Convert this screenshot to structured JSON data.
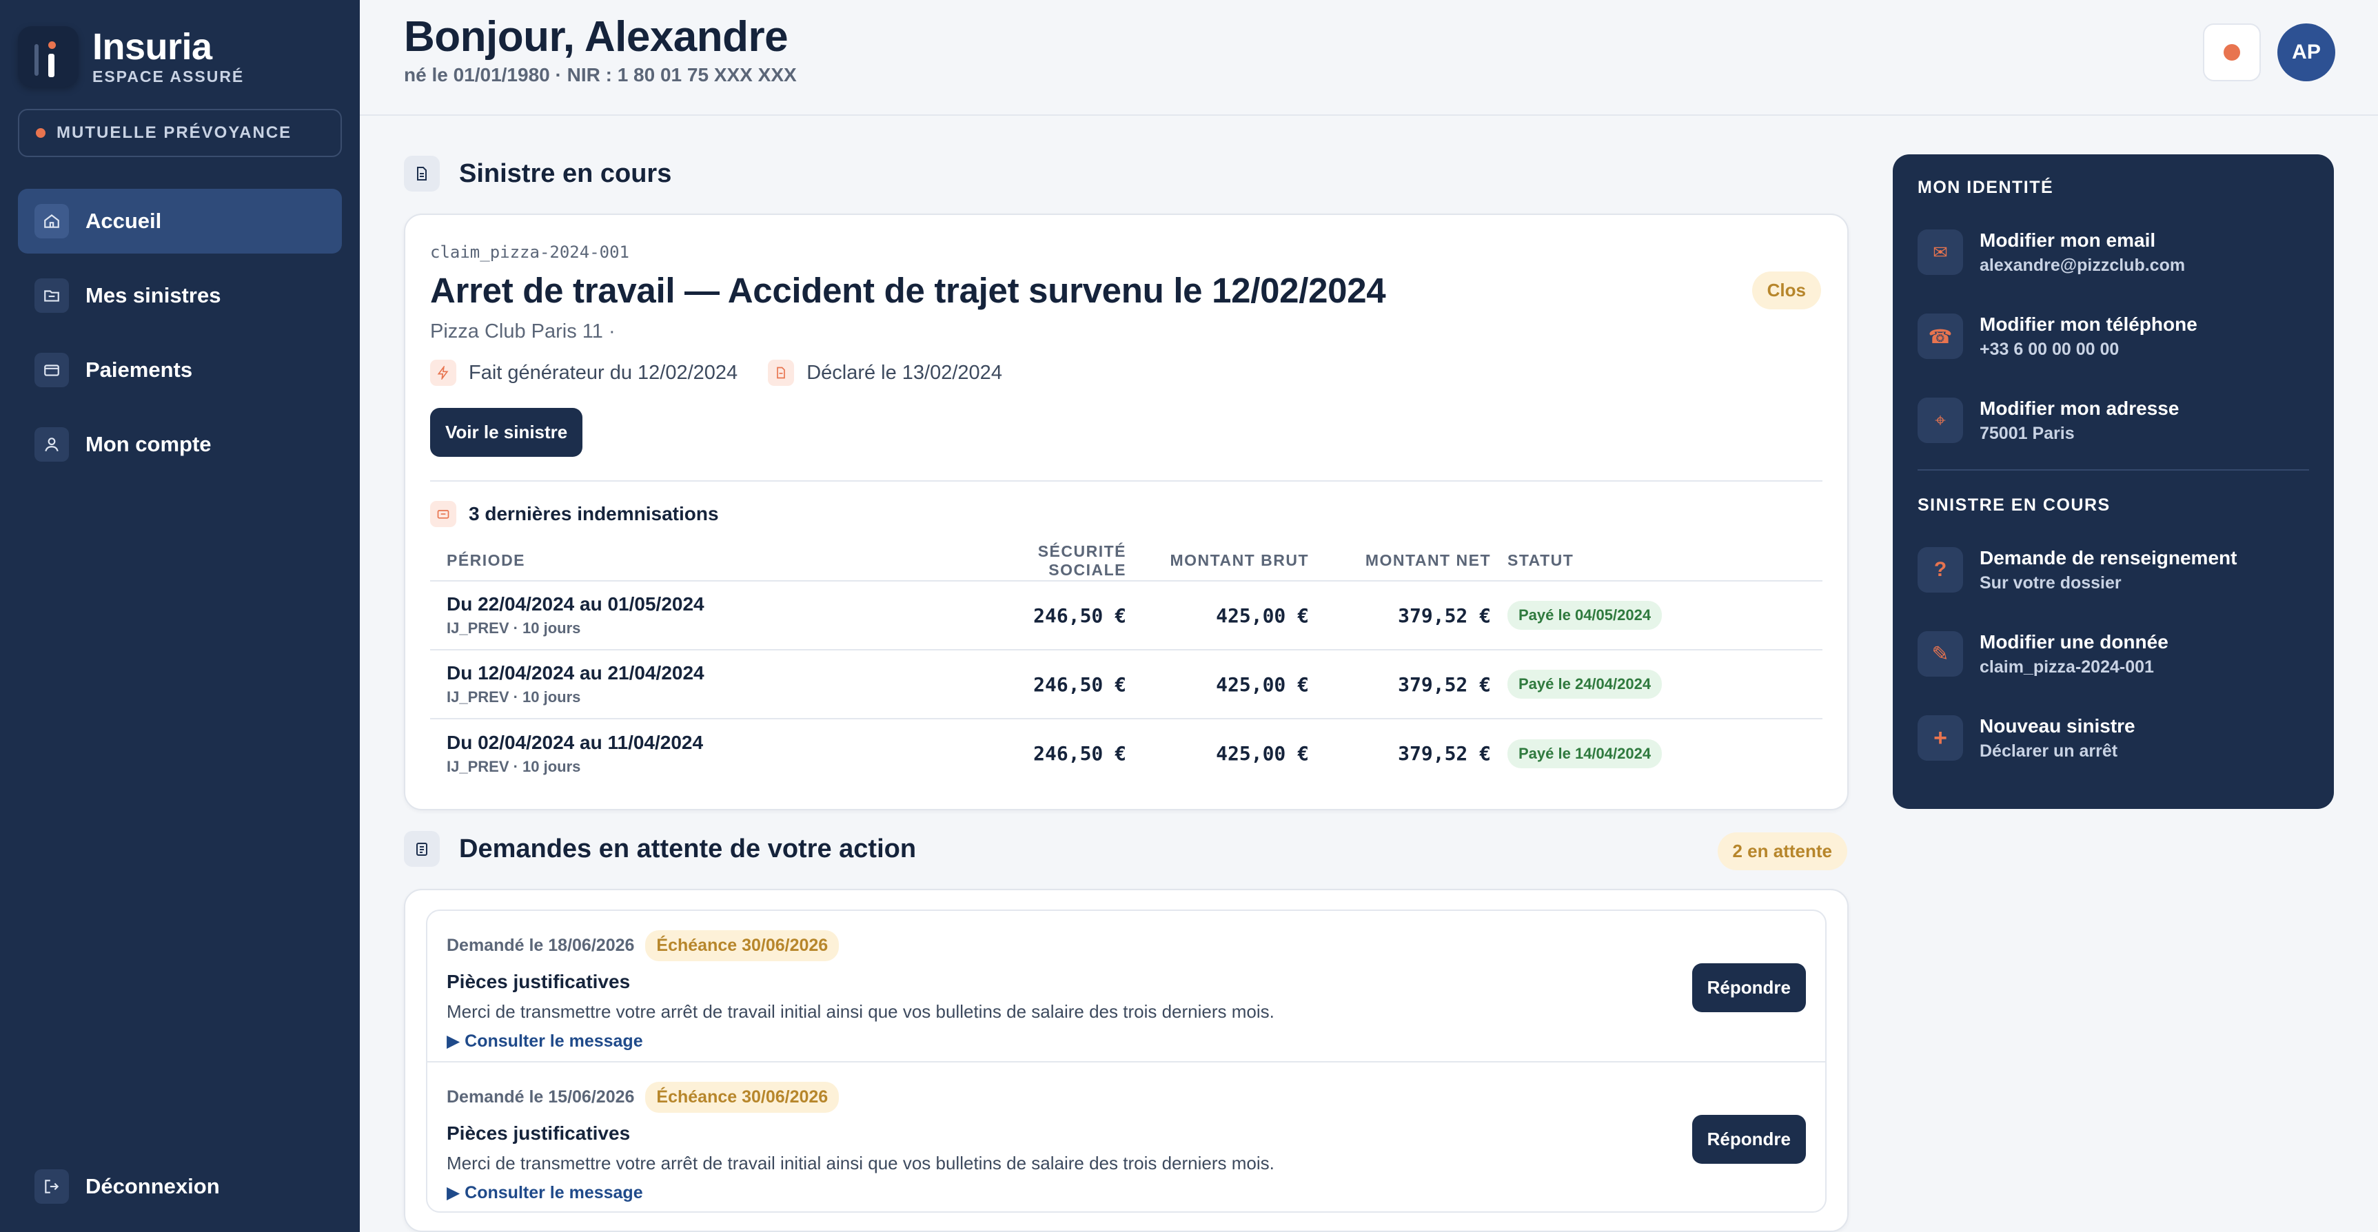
{
  "brand": {
    "name": "Insuria",
    "subtitle": "ESPACE ASSURÉ"
  },
  "mutuelle_label": "MUTUELLE PRÉVOYANCE",
  "nav": {
    "items": [
      {
        "label": "Accueil",
        "icon": "home-icon",
        "active": true
      },
      {
        "label": "Mes sinistres",
        "icon": "folder-icon"
      },
      {
        "label": "Paiements",
        "icon": "wallet-icon"
      },
      {
        "label": "Mon compte",
        "icon": "user-icon"
      }
    ],
    "logout": "Déconnexion"
  },
  "header": {
    "greeting": "Bonjour, Alexandre",
    "subline": "né le 01/01/1980 · NIR : 1 80 01 75 XXX XXX",
    "avatar": "AP"
  },
  "claim_section": {
    "title": "Sinistre en cours",
    "id": "claim_pizza-2024-001",
    "claim_title": "Arret de travail — Accident de trajet survenu le 12/02/2024",
    "company": "Pizza Club Paris 11 ·",
    "status": "Clos",
    "fait": "Fait générateur du 12/02/2024",
    "declare": "Déclaré le 13/02/2024",
    "button": "Voir le sinistre",
    "indem_title": "3 dernières indemnisations",
    "columns": [
      "PÉRIODE",
      "SÉCURITÉ SOCIALE",
      "MONTANT BRUT",
      "MONTANT NET",
      "STATUT"
    ],
    "rows": [
      {
        "period": "Du 22/04/2024 au 01/05/2024",
        "sub": "IJ_PREV · 10 jours",
        "ss": "246,50 €",
        "brut": "425,00 €",
        "net": "379,52 €",
        "status": "Payé le 04/05/2024"
      },
      {
        "period": "Du 12/04/2024 au 21/04/2024",
        "sub": "IJ_PREV · 10 jours",
        "ss": "246,50 €",
        "brut": "425,00 €",
        "net": "379,52 €",
        "status": "Payé le 24/04/2024"
      },
      {
        "period": "Du 02/04/2024 au 11/04/2024",
        "sub": "IJ_PREV · 10 jours",
        "ss": "246,50 €",
        "brut": "425,00 €",
        "net": "379,52 €",
        "status": "Payé le 14/04/2024"
      }
    ]
  },
  "requests_section": {
    "title": "Demandes en attente de votre action",
    "badge": "2 en attente",
    "items": [
      {
        "date": "Demandé le 18/06/2026",
        "due": "Échéance 30/06/2026",
        "title": "Pièces justificatives",
        "desc": "Merci de transmettre votre arrêt de travail initial ainsi que vos bulletins de salaire des trois derniers mois.",
        "link": "▶ Consulter le message",
        "button": "Répondre"
      },
      {
        "date": "Demandé le 15/06/2026",
        "due": "Échéance 30/06/2026",
        "title": "Pièces justificatives",
        "desc": "Merci de transmettre votre arrêt de travail initial ainsi que vos bulletins de salaire des trois derniers mois.",
        "link": "▶ Consulter le message",
        "button": "Répondre"
      }
    ]
  },
  "panel": {
    "identity_title": "MON IDENTITÉ",
    "identity": [
      {
        "title": "Modifier mon email",
        "sub": "alexandre@pizzclub.com",
        "icon": "mail-icon",
        "glyph": "✉"
      },
      {
        "title": "Modifier mon téléphone",
        "sub": "+33 6 00 00 00 00",
        "icon": "phone-icon",
        "glyph": "☎"
      },
      {
        "title": "Modifier mon adresse",
        "sub": "75001 Paris",
        "icon": "location-icon",
        "glyph": "⌖"
      }
    ],
    "claim_title": "SINISTRE EN COURS",
    "claim": [
      {
        "title": "Demande de renseignement",
        "sub": "Sur votre dossier",
        "icon": "question-icon",
        "glyph": "?"
      },
      {
        "title": "Modifier une donnée",
        "sub": "claim_pizza-2024-001",
        "icon": "pencil-icon",
        "glyph": "✎"
      },
      {
        "title": "Nouveau sinistre",
        "sub": "Déclarer un arrêt",
        "icon": "plus-icon",
        "glyph": "+"
      }
    ]
  },
  "colors": {
    "sidebar": "#1c2e4c",
    "accent": "#e8744f",
    "paid": "#2f7a3e",
    "warning": "#b7862b"
  }
}
